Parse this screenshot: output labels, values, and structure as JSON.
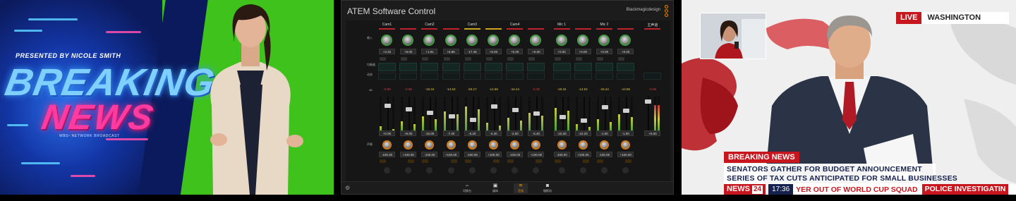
{
  "left": {
    "presented_by": "PRESENTED BY NICOLE SMITH",
    "breaking": "BREAKING",
    "news": "NEWS",
    "network": "WBS¹ NETWORK BROADCAST"
  },
  "atem": {
    "title": "ATEM Software Control",
    "brand": "Blackmagicdesign",
    "side_labels": [
      "输入",
      "均衡器",
      "动态",
      "dB",
      "声像"
    ],
    "channels": [
      {
        "name": "Cam1",
        "gain": "+3.32",
        "db": "-0.98",
        "level": "+0.00",
        "pan": "-100.00",
        "bar": "red"
      },
      {
        "name": "",
        "gain": "+6.00",
        "db": "-0.98",
        "level": "+6.00",
        "pan": "+100.00",
        "bar": "red"
      },
      {
        "name": "Cam2",
        "gain": "+1.81",
        "db": "-19.34",
        "level": "-15.00",
        "pan": "-100.00",
        "bar": "red"
      },
      {
        "name": "",
        "gain": "+6.86",
        "db": "-14.63",
        "level": "-7.40",
        "pan": "+100.00",
        "bar": "red"
      },
      {
        "name": "Cam3",
        "gain": "-17.48",
        "db": "-63.17",
        "level": "-5.20",
        "pan": "-100.00",
        "bar": "yellow"
      },
      {
        "name": "",
        "gain": "+6.00",
        "db": "-14.86",
        "level": "-2.40",
        "pan": "+100.00",
        "bar": "yellow"
      },
      {
        "name": "Cam4",
        "gain": "+0.00",
        "db": "-16.44",
        "level": "-2.00",
        "pan": "-100.00",
        "bar": "red"
      },
      {
        "name": "",
        "gain": "+6.00",
        "db": "-6.30",
        "level": "-6.40",
        "pan": "+100.00",
        "bar": "red"
      },
      {
        "name": "Mic 1",
        "gain": "+0.00",
        "db": "-19.34",
        "level": "-10.20",
        "pan": "-100.00",
        "bar": "red"
      },
      {
        "name": "",
        "gain": "+0.00",
        "db": "-14.63",
        "level": "-10.20",
        "pan": "+100.00",
        "bar": "red"
      },
      {
        "name": "Mic 2",
        "gain": "+0.00",
        "db": "-16.44",
        "level": "-1.00",
        "pan": "-100.00",
        "bar": "red"
      },
      {
        "name": "",
        "gain": "+0.00",
        "db": "-14.86",
        "level": "-1.00",
        "pan": "+100.00",
        "bar": "red"
      }
    ],
    "master": {
      "name": "主声道",
      "db": "-0.98",
      "level": "+0.00"
    },
    "bottom_tabs": [
      {
        "glyph": "⇔",
        "label": "切换台"
      },
      {
        "glyph": "▣",
        "label": "媒体"
      },
      {
        "glyph": "≋",
        "label": "音频"
      },
      {
        "glyph": "◙",
        "label": "摄影机"
      }
    ]
  },
  "right": {
    "live": "LIVE",
    "location": "WASHINGTON",
    "breaking_label": "BREAKING NEWS",
    "headline1": "SENATORS GATHER FOR BUDGET ANNOUNCEMENT",
    "headline2": "SERIES OF TAX CUTS ANTICIPATED FOR SMALL BUSINESSES",
    "ticker_brand": "NEWS",
    "ticker_24": "24",
    "ticker_time": "17:36",
    "ticker_text": "YER OUT OF WORLD CUP SQUAD",
    "ticker_text2": "POLICE INVESTIGATIN"
  }
}
